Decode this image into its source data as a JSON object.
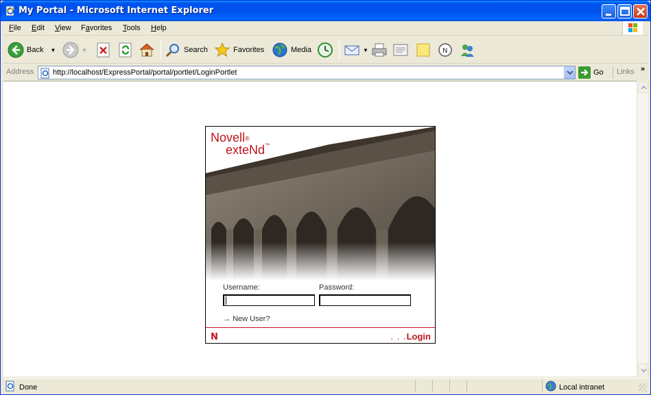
{
  "window": {
    "title": "My Portal - Microsoft Internet Explorer"
  },
  "menu": {
    "items": [
      {
        "label": "File",
        "accel": "F",
        "rest": "ile"
      },
      {
        "label": "Edit",
        "accel": "E",
        "rest": "dit"
      },
      {
        "label": "View",
        "accel": "V",
        "rest": "iew"
      },
      {
        "label": "Favorites",
        "accel": "a",
        "pre": "F",
        "rest": "vorites"
      },
      {
        "label": "Tools",
        "accel": "T",
        "rest": "ools"
      },
      {
        "label": "Help",
        "accel": "H",
        "rest": "elp"
      }
    ]
  },
  "toolbar": {
    "back_label": "Back",
    "search_label": "Search",
    "favorites_label": "Favorites",
    "media_label": "Media"
  },
  "address": {
    "label": "Address",
    "url": "http://localhost/ExpressPortal/portal/portlet/LoginPortlet",
    "go_label": "Go",
    "links_label": "Links",
    "more_label": "»"
  },
  "login": {
    "brand_line1": "Novell",
    "brand_reg": "®",
    "brand_line2": "exteNd",
    "brand_tm": "™",
    "username_label": "Username:",
    "password_label": "Password:",
    "username_value": "",
    "password_value": "",
    "new_user_arrow": "→",
    "new_user_label": "New User?",
    "footer_logo": "N",
    "login_dots": ". . .",
    "login_label": "Login"
  },
  "status": {
    "text": "Done",
    "zone": "Local intranet"
  },
  "colors": {
    "brand_red": "#c0141c",
    "title_blue": "#0053ee",
    "chrome": "#ece9d8"
  }
}
